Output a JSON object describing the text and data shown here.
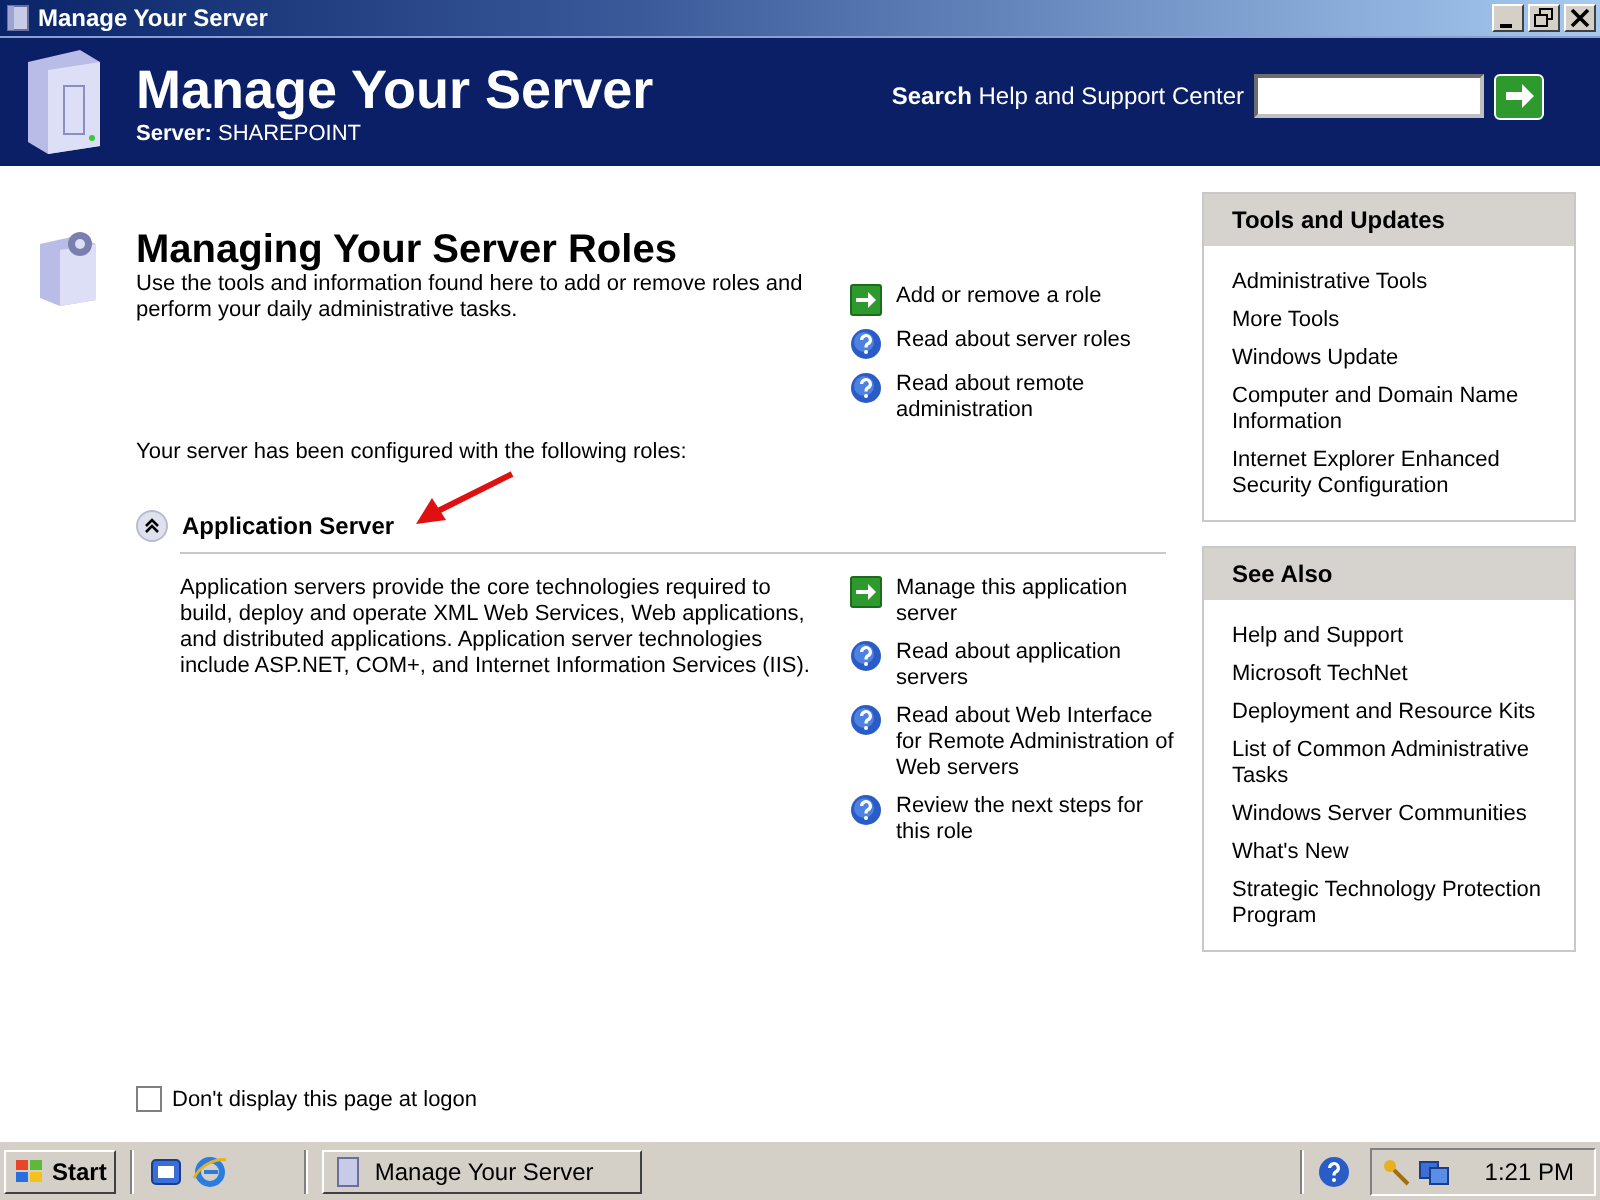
{
  "window": {
    "title": "Manage Your Server"
  },
  "header": {
    "title": "Manage Your Server",
    "server_label": "Server:",
    "server_name": "SHAREPOINT",
    "search_bold": "Search",
    "search_label": "Help and Support Center"
  },
  "intro": {
    "title": "Managing Your Server Roles",
    "description": "Use the tools and information found here to add or remove roles and perform your daily administrative tasks.",
    "links": [
      {
        "kind": "arrow",
        "text": "Add or remove a role"
      },
      {
        "kind": "help",
        "text": "Read about server roles"
      },
      {
        "kind": "help",
        "text": "Read about remote administration"
      }
    ]
  },
  "roles_text": "Your server has been configured with the following roles:",
  "roles": [
    {
      "name": "Application Server",
      "expanded": true,
      "description": "Application servers provide the core technologies required to build, deploy and operate XML Web Services, Web applications, and distributed applications. Application server technologies include ASP.NET, COM+, and Internet Information Services (IIS).",
      "links": [
        {
          "kind": "arrow",
          "text": "Manage this application server"
        },
        {
          "kind": "help",
          "text": "Read about application servers"
        },
        {
          "kind": "help",
          "text": "Read about Web Interface for Remote Administration of Web servers"
        },
        {
          "kind": "help",
          "text": "Review the next steps for this role"
        }
      ]
    }
  ],
  "sidebar": [
    {
      "title": "Tools and Updates",
      "links": [
        "Administrative Tools",
        "More Tools",
        "Windows Update",
        "Computer and Domain Name Information",
        "Internet Explorer Enhanced Security Configuration"
      ]
    },
    {
      "title": "See Also",
      "links": [
        "Help and Support",
        "Microsoft TechNet",
        "Deployment and Resource Kits",
        "List of Common Administrative Tasks",
        "Windows Server Communities",
        "What's New",
        "Strategic Technology Protection Program"
      ]
    }
  ],
  "logon_checkbox": {
    "label": "Don't display this page at logon",
    "checked": false
  },
  "taskbar": {
    "start": "Start",
    "tasks": [
      {
        "label": "Manage Your Server",
        "selected": false
      }
    ],
    "clock": "1:21 PM"
  }
}
